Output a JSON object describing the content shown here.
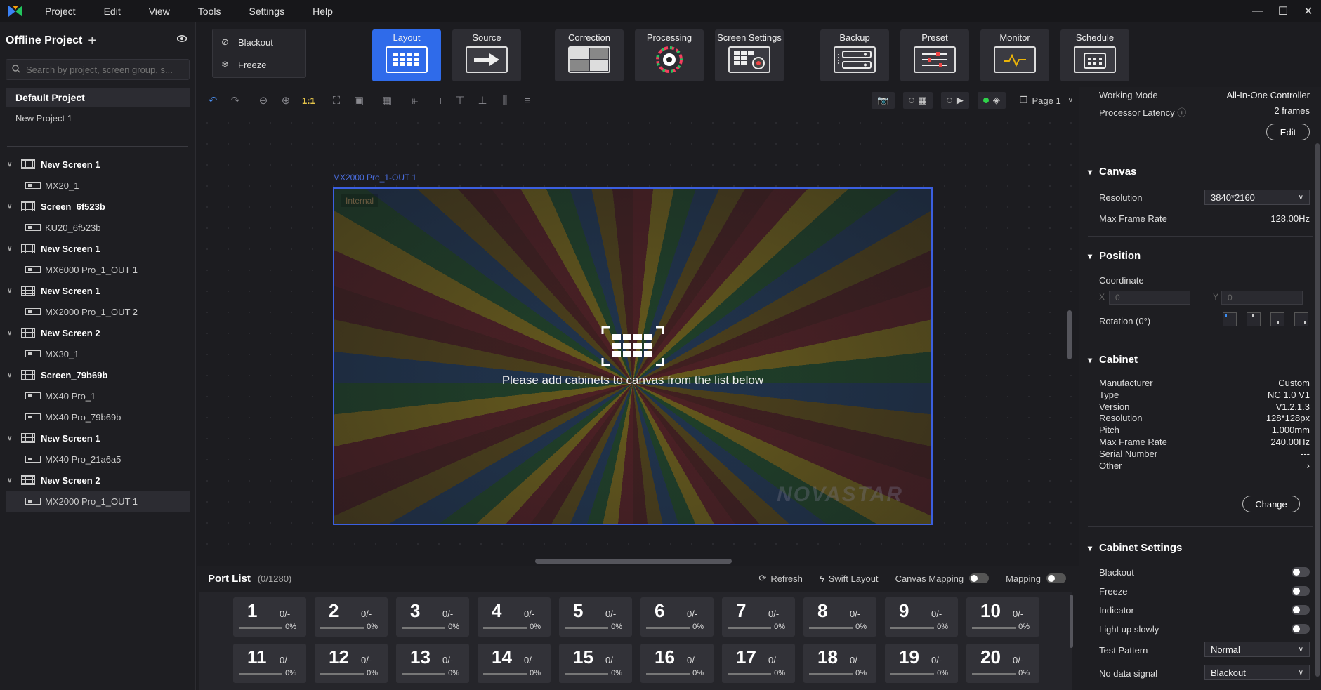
{
  "menu": [
    "Project",
    "Edit",
    "View",
    "Tools",
    "Settings",
    "Help"
  ],
  "left": {
    "title": "Offline Project",
    "search_placeholder": "Search by project, screen group, s...",
    "default_project": "Default Project",
    "new_project": "New Project 1",
    "tree": [
      {
        "screen": "New Screen 1",
        "child": "MX20_1"
      },
      {
        "screen": "Screen_6f523b",
        "child": "KU20_6f523b"
      },
      {
        "screen": "New Screen 1",
        "child": "MX6000 Pro_1_OUT 1"
      },
      {
        "screen": "New Screen 1",
        "child": "MX2000 Pro_1_OUT 2"
      },
      {
        "screen": "New Screen 2",
        "child": "MX30_1"
      },
      {
        "screen": "Screen_79b69b",
        "children": [
          "MX40 Pro_1",
          "MX40 Pro_79b69b"
        ]
      },
      {
        "screen": "New Screen 1",
        "child": "MX40 Pro_21a6a5"
      },
      {
        "screen": "New Screen 2",
        "child": "MX2000 Pro_1_OUT 1"
      }
    ]
  },
  "toolbar": {
    "blackout": "Blackout",
    "freeze": "Freeze",
    "buttons": [
      "Layout",
      "Source",
      "Correction",
      "Processing",
      "Screen Settings",
      "Backup",
      "Preset",
      "Monitor",
      "Schedule"
    ],
    "active": "Layout"
  },
  "canvas_tools": {
    "zoom_reset": "1:1",
    "page": "Page 1"
  },
  "canvas": {
    "label": "MX2000 Pro_1-OUT 1",
    "internal": "Internal",
    "message": "Please add cabinets to canvas from the list below",
    "watermark": "NOVASTAR"
  },
  "portlist": {
    "title": "Port List",
    "count": "(0/1280)",
    "refresh": "Refresh",
    "swift": "Swift Layout",
    "canvas_mapping": "Canvas Mapping",
    "mapping": "Mapping",
    "ports": [
      {
        "n": "1",
        "frac": "0/-",
        "pct": "0%"
      },
      {
        "n": "2",
        "frac": "0/-",
        "pct": "0%"
      },
      {
        "n": "3",
        "frac": "0/-",
        "pct": "0%"
      },
      {
        "n": "4",
        "frac": "0/-",
        "pct": "0%"
      },
      {
        "n": "5",
        "frac": "0/-",
        "pct": "0%"
      },
      {
        "n": "6",
        "frac": "0/-",
        "pct": "0%"
      },
      {
        "n": "7",
        "frac": "0/-",
        "pct": "0%"
      },
      {
        "n": "8",
        "frac": "0/-",
        "pct": "0%"
      },
      {
        "n": "9",
        "frac": "0/-",
        "pct": "0%"
      },
      {
        "n": "10",
        "frac": "0/-",
        "pct": "0%"
      },
      {
        "n": "11",
        "frac": "0/-",
        "pct": "0%"
      },
      {
        "n": "12",
        "frac": "0/-",
        "pct": "0%"
      },
      {
        "n": "13",
        "frac": "0/-",
        "pct": "0%"
      },
      {
        "n": "14",
        "frac": "0/-",
        "pct": "0%"
      },
      {
        "n": "15",
        "frac": "0/-",
        "pct": "0%"
      },
      {
        "n": "16",
        "frac": "0/-",
        "pct": "0%"
      },
      {
        "n": "17",
        "frac": "0/-",
        "pct": "0%"
      },
      {
        "n": "18",
        "frac": "0/-",
        "pct": "0%"
      },
      {
        "n": "19",
        "frac": "0/-",
        "pct": "0%"
      },
      {
        "n": "20",
        "frac": "0/-",
        "pct": "0%"
      }
    ]
  },
  "right": {
    "working_mode_label": "Working Mode",
    "working_mode_value": "All-In-One Controller",
    "latency_label": "Processor Latency",
    "latency_value": "2 frames",
    "edit": "Edit",
    "canvas": {
      "title": "Canvas",
      "resolution_label": "Resolution",
      "resolution_value": "3840*2160",
      "max_fr_label": "Max Frame Rate",
      "max_fr_value": "128.00Hz"
    },
    "position": {
      "title": "Position",
      "coordinate": "Coordinate",
      "x_label": "X",
      "x_value": "0",
      "y_label": "Y",
      "y_value": "0",
      "rotation": "Rotation (0°)"
    },
    "cabinet": {
      "title": "Cabinet",
      "rows": [
        {
          "k": "Manufacturer",
          "v": "Custom"
        },
        {
          "k": "Type",
          "v": "NC 1.0 V1"
        },
        {
          "k": "Version",
          "v": "V1.2.1.3"
        },
        {
          "k": "Resolution",
          "v": "128*128px"
        },
        {
          "k": "Pitch",
          "v": "1.000mm"
        },
        {
          "k": "Max Frame Rate",
          "v": "240.00Hz"
        },
        {
          "k": "Serial Number",
          "v": "---"
        },
        {
          "k": "Other",
          "v": "›"
        }
      ],
      "change": "Change"
    },
    "cabinet_settings": {
      "title": "Cabinet Settings",
      "toggles": [
        "Blackout",
        "Freeze",
        "Indicator",
        "Light up slowly"
      ],
      "test_pattern_label": "Test Pattern",
      "test_pattern_value": "Normal",
      "no_data_label": "No data signal",
      "no_data_value": "Blackout"
    }
  }
}
